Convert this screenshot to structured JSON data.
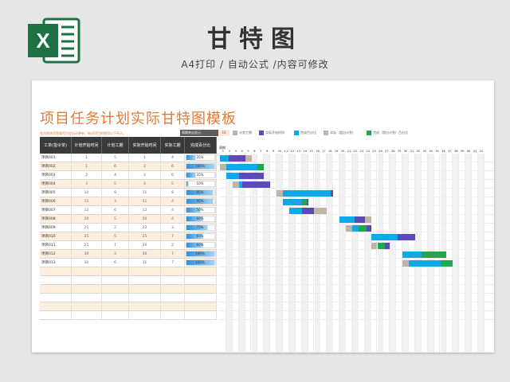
{
  "banner": {
    "title": "甘特图",
    "subtitle": "A4打印 / 自动公式 /内容可修改",
    "excel_icon": "excel-logo-icon",
    "excel_green": "#1e7145"
  },
  "sheet": {
    "title": "项目任务计划实际甘特图模板",
    "note": "在在期选项里填写后会自动更新，每进项目的图用以下所示。",
    "period_label": "周期突出显示：",
    "period_value": "10",
    "legend": [
      {
        "label": "计划工期",
        "color": "#c0b4a6"
      },
      {
        "label": "实际开始时间",
        "color": "#5b4bb8"
      },
      {
        "label": "完成百分比",
        "color": "#10a8e8"
      },
      {
        "label": "实际（超出计划）",
        "color": "#c0b4a6"
      },
      {
        "label": "完成（超出计划）百分比",
        "color": "#1fa84f"
      }
    ],
    "headers": [
      "工单(指令单)",
      "计划开始时间",
      "计划工期",
      "实际开始时间",
      "实际工期",
      "完成百分比"
    ],
    "rows": [
      {
        "name": "项目001",
        "plan_start": "1",
        "plan_dur": "5",
        "act_start": "1",
        "act_dur": "4",
        "pct": 35,
        "pct_label": "35%"
      },
      {
        "name": "项目002",
        "plan_start": "1",
        "plan_dur": "6",
        "act_start": "2",
        "act_dur": "6",
        "pct": 100,
        "pct_label": "100%"
      },
      {
        "name": "项目003",
        "plan_start": "2",
        "plan_dur": "4",
        "act_start": "2",
        "act_dur": "6",
        "pct": 35,
        "pct_label": "35%"
      },
      {
        "name": "项目004",
        "plan_start": "3",
        "plan_dur": "5",
        "act_start": "4",
        "act_dur": "5",
        "pct": 10,
        "pct_label": "10%"
      },
      {
        "name": "项目005",
        "plan_start": "10",
        "plan_dur": "9",
        "act_start": "11",
        "act_dur": "8",
        "pct": 95,
        "pct_label": "95%"
      },
      {
        "name": "项目006",
        "plan_start": "11",
        "plan_dur": "3",
        "act_start": "11",
        "act_dur": "4",
        "pct": 95,
        "pct_label": "95%"
      },
      {
        "name": "项目007",
        "plan_start": "12",
        "plan_dur": "6",
        "act_start": "12",
        "act_dur": "4",
        "pct": 50,
        "pct_label": "50%"
      },
      {
        "name": "项目008",
        "plan_start": "20",
        "plan_dur": "5",
        "act_start": "20",
        "act_dur": "4",
        "pct": 60,
        "pct_label": "60%"
      },
      {
        "name": "项目009",
        "plan_start": "21",
        "plan_dur": "2",
        "act_start": "22",
        "act_dur": "3",
        "pct": 75,
        "pct_label": "75%"
      },
      {
        "name": "项目010",
        "plan_start": "25",
        "plan_dur": "5",
        "act_start": "25",
        "act_dur": "7",
        "pct": 60,
        "pct_label": "60%"
      },
      {
        "name": "项目011",
        "plan_start": "25",
        "plan_dur": "1",
        "act_start": "26",
        "act_dur": "2",
        "pct": 60,
        "pct_label": "60%"
      },
      {
        "name": "项目012",
        "plan_start": "30",
        "plan_dur": "3",
        "act_start": "30",
        "act_dur": "7",
        "pct": 100,
        "pct_label": "100%"
      },
      {
        "name": "项目013",
        "plan_start": "30",
        "plan_dur": "6",
        "act_start": "31",
        "act_dur": "7",
        "pct": 100,
        "pct_label": "100%"
      }
    ],
    "empty_rows": 6,
    "gantt_header_label": "周期",
    "days": [
      "1",
      "2",
      "3",
      "4",
      "5",
      "6",
      "7",
      "8",
      "9",
      "10",
      "11",
      "12",
      "13",
      "14",
      "15",
      "16",
      "17",
      "18",
      "19",
      "20",
      "21",
      "22",
      "23",
      "24",
      "25",
      "26",
      "27",
      "28",
      "29",
      "30",
      "31",
      "32",
      "33",
      "34",
      "35",
      "36",
      "37",
      "38",
      "39",
      "40",
      "41",
      "42"
    ],
    "colors": {
      "plan": "#c0b4a6",
      "actual": "#5b4bb8",
      "complete": "#10a8e8",
      "over_complete": "#1fa84f",
      "title_orange": "#e07b39",
      "row_alt": "#fdeedd",
      "header_dark": "#3a3a3a"
    }
  }
}
